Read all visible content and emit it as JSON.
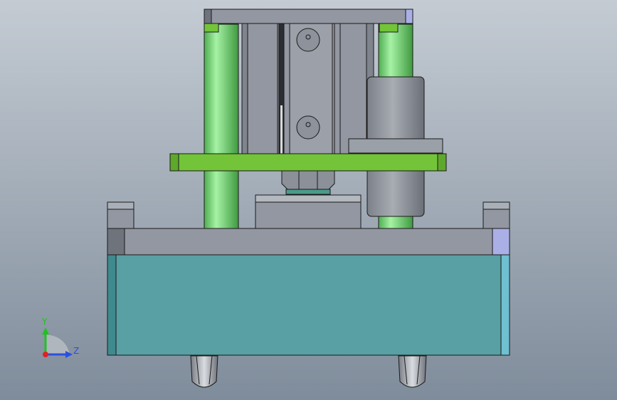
{
  "viewport": {
    "background_top": "#c4cbd3",
    "background_bottom": "#7f8c9b"
  },
  "colors": {
    "green_rod": "#88e888",
    "green_plate": "#74c43a",
    "teal_body": "#58a0a4",
    "steel": "#9297a1",
    "steel_light": "#b4b8bf",
    "steel_dark": "#6e737c",
    "edge_blue": "#aab0e6",
    "outline": "#1a1a1a"
  },
  "model": {
    "parts": [
      "top-cap-plate",
      "left-guide-rod",
      "right-guide-rod",
      "cylinder-body",
      "mounting-plate",
      "side-sleeve",
      "center-nut",
      "center-block",
      "base-frame",
      "base-body",
      "left-foot",
      "right-foot"
    ]
  },
  "triad": {
    "y_label": "Y",
    "z_label": "Z",
    "y_color": "#22c122",
    "z_color": "#2a4fe0",
    "x_color": "#e02222"
  }
}
